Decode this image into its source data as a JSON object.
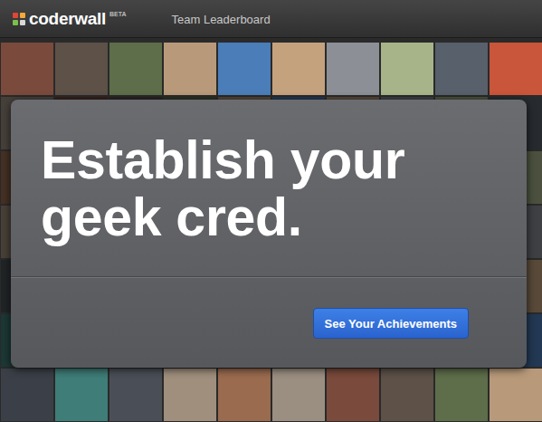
{
  "header": {
    "logo": "coderwall",
    "badge": "BETA",
    "nav": [
      {
        "label": "Team Leaderboard",
        "selected": false
      }
    ]
  },
  "hero": {
    "headline": "Establish your geek cred.",
    "button": "See Your Achievements"
  }
}
